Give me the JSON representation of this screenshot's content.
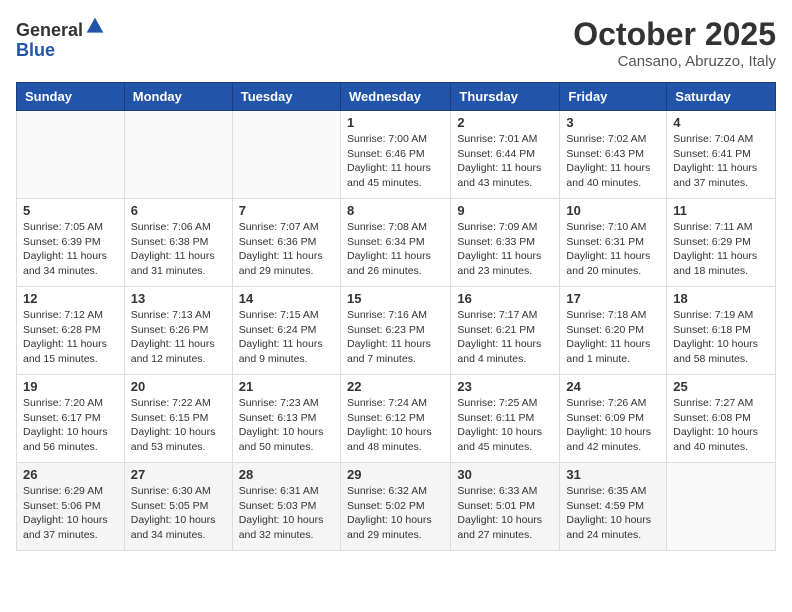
{
  "header": {
    "logo_line1": "General",
    "logo_line2": "Blue",
    "month": "October 2025",
    "location": "Cansano, Abruzzo, Italy"
  },
  "days_of_week": [
    "Sunday",
    "Monday",
    "Tuesday",
    "Wednesday",
    "Thursday",
    "Friday",
    "Saturday"
  ],
  "weeks": [
    [
      {
        "day": "",
        "info": ""
      },
      {
        "day": "",
        "info": ""
      },
      {
        "day": "",
        "info": ""
      },
      {
        "day": "1",
        "info": "Sunrise: 7:00 AM\nSunset: 6:46 PM\nDaylight: 11 hours and 45 minutes."
      },
      {
        "day": "2",
        "info": "Sunrise: 7:01 AM\nSunset: 6:44 PM\nDaylight: 11 hours and 43 minutes."
      },
      {
        "day": "3",
        "info": "Sunrise: 7:02 AM\nSunset: 6:43 PM\nDaylight: 11 hours and 40 minutes."
      },
      {
        "day": "4",
        "info": "Sunrise: 7:04 AM\nSunset: 6:41 PM\nDaylight: 11 hours and 37 minutes."
      }
    ],
    [
      {
        "day": "5",
        "info": "Sunrise: 7:05 AM\nSunset: 6:39 PM\nDaylight: 11 hours and 34 minutes."
      },
      {
        "day": "6",
        "info": "Sunrise: 7:06 AM\nSunset: 6:38 PM\nDaylight: 11 hours and 31 minutes."
      },
      {
        "day": "7",
        "info": "Sunrise: 7:07 AM\nSunset: 6:36 PM\nDaylight: 11 hours and 29 minutes."
      },
      {
        "day": "8",
        "info": "Sunrise: 7:08 AM\nSunset: 6:34 PM\nDaylight: 11 hours and 26 minutes."
      },
      {
        "day": "9",
        "info": "Sunrise: 7:09 AM\nSunset: 6:33 PM\nDaylight: 11 hours and 23 minutes."
      },
      {
        "day": "10",
        "info": "Sunrise: 7:10 AM\nSunset: 6:31 PM\nDaylight: 11 hours and 20 minutes."
      },
      {
        "day": "11",
        "info": "Sunrise: 7:11 AM\nSunset: 6:29 PM\nDaylight: 11 hours and 18 minutes."
      }
    ],
    [
      {
        "day": "12",
        "info": "Sunrise: 7:12 AM\nSunset: 6:28 PM\nDaylight: 11 hours and 15 minutes."
      },
      {
        "day": "13",
        "info": "Sunrise: 7:13 AM\nSunset: 6:26 PM\nDaylight: 11 hours and 12 minutes."
      },
      {
        "day": "14",
        "info": "Sunrise: 7:15 AM\nSunset: 6:24 PM\nDaylight: 11 hours and 9 minutes."
      },
      {
        "day": "15",
        "info": "Sunrise: 7:16 AM\nSunset: 6:23 PM\nDaylight: 11 hours and 7 minutes."
      },
      {
        "day": "16",
        "info": "Sunrise: 7:17 AM\nSunset: 6:21 PM\nDaylight: 11 hours and 4 minutes."
      },
      {
        "day": "17",
        "info": "Sunrise: 7:18 AM\nSunset: 6:20 PM\nDaylight: 11 hours and 1 minute."
      },
      {
        "day": "18",
        "info": "Sunrise: 7:19 AM\nSunset: 6:18 PM\nDaylight: 10 hours and 58 minutes."
      }
    ],
    [
      {
        "day": "19",
        "info": "Sunrise: 7:20 AM\nSunset: 6:17 PM\nDaylight: 10 hours and 56 minutes."
      },
      {
        "day": "20",
        "info": "Sunrise: 7:22 AM\nSunset: 6:15 PM\nDaylight: 10 hours and 53 minutes."
      },
      {
        "day": "21",
        "info": "Sunrise: 7:23 AM\nSunset: 6:13 PM\nDaylight: 10 hours and 50 minutes."
      },
      {
        "day": "22",
        "info": "Sunrise: 7:24 AM\nSunset: 6:12 PM\nDaylight: 10 hours and 48 minutes."
      },
      {
        "day": "23",
        "info": "Sunrise: 7:25 AM\nSunset: 6:11 PM\nDaylight: 10 hours and 45 minutes."
      },
      {
        "day": "24",
        "info": "Sunrise: 7:26 AM\nSunset: 6:09 PM\nDaylight: 10 hours and 42 minutes."
      },
      {
        "day": "25",
        "info": "Sunrise: 7:27 AM\nSunset: 6:08 PM\nDaylight: 10 hours and 40 minutes."
      }
    ],
    [
      {
        "day": "26",
        "info": "Sunrise: 6:29 AM\nSunset: 5:06 PM\nDaylight: 10 hours and 37 minutes."
      },
      {
        "day": "27",
        "info": "Sunrise: 6:30 AM\nSunset: 5:05 PM\nDaylight: 10 hours and 34 minutes."
      },
      {
        "day": "28",
        "info": "Sunrise: 6:31 AM\nSunset: 5:03 PM\nDaylight: 10 hours and 32 minutes."
      },
      {
        "day": "29",
        "info": "Sunrise: 6:32 AM\nSunset: 5:02 PM\nDaylight: 10 hours and 29 minutes."
      },
      {
        "day": "30",
        "info": "Sunrise: 6:33 AM\nSunset: 5:01 PM\nDaylight: 10 hours and 27 minutes."
      },
      {
        "day": "31",
        "info": "Sunrise: 6:35 AM\nSunset: 4:59 PM\nDaylight: 10 hours and 24 minutes."
      },
      {
        "day": "",
        "info": ""
      }
    ]
  ]
}
